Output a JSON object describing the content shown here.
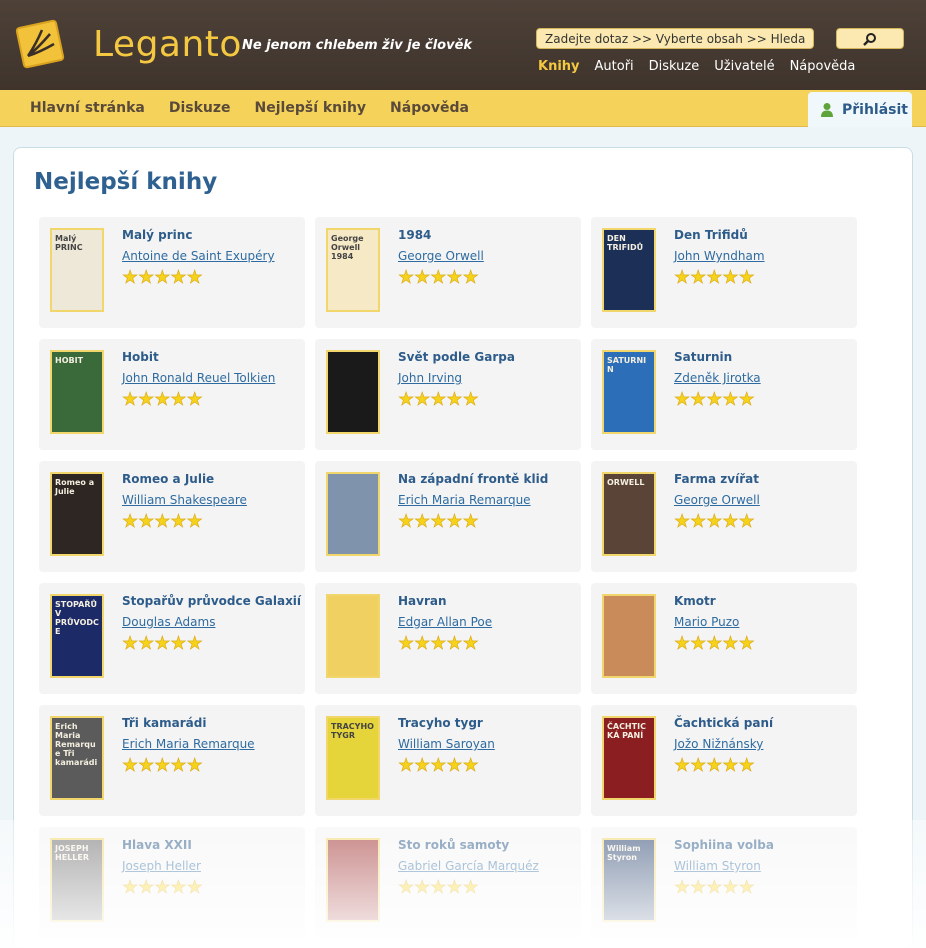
{
  "brand": {
    "name": "Leganto",
    "tagline": "Ne jenom chlebem živ je člověk"
  },
  "search": {
    "placeholder": "Zadejte dotaz >> Vyberte obsah >> Hledat"
  },
  "top_nav": [
    {
      "label": "Knihy",
      "active": true
    },
    {
      "label": "Autoři",
      "active": false
    },
    {
      "label": "Diskuze",
      "active": false
    },
    {
      "label": "Uživatelé",
      "active": false
    },
    {
      "label": "Nápověda",
      "active": false
    }
  ],
  "sub_nav": [
    "Hlavní stránka",
    "Diskuze",
    "Nejlepší knihy",
    "Nápověda"
  ],
  "login": {
    "label": "Přihlásit"
  },
  "page": {
    "title": "Nejlepší knihy"
  },
  "colors": {
    "header": "#4a3e36",
    "accent": "#f5c842",
    "bar": "#f5d35a",
    "link": "#2e5c8a"
  },
  "books": [
    {
      "title": "Malý princ",
      "author": "Antoine de Saint Exupéry",
      "rating": 5,
      "cover_color": "#ede8d8",
      "cover_text": "Malý PRINC"
    },
    {
      "title": "1984",
      "author": "George Orwell",
      "rating": 5,
      "cover_color": "#f6e9c6",
      "cover_text": "George Orwell 1984"
    },
    {
      "title": "Den Trifidů",
      "author": "John Wyndham",
      "rating": 5,
      "cover_color": "#1c2f57",
      "cover_text": "DEN TRIFIDŮ"
    },
    {
      "title": "Hobit",
      "author": "John Ronald Reuel Tolkien",
      "rating": 5,
      "cover_color": "#3b6a3a",
      "cover_text": "HOBIT"
    },
    {
      "title": "Svět podle Garpa",
      "author": "John Irving",
      "rating": 5,
      "cover_color": "#1a1a1a",
      "cover_text": ""
    },
    {
      "title": "Saturnin",
      "author": "Zdeněk Jirotka",
      "rating": 5,
      "cover_color": "#2c6fb8",
      "cover_text": "SATURNIN"
    },
    {
      "title": "Romeo a Julie",
      "author": "William Shakespeare",
      "rating": 5,
      "cover_color": "#2d2622",
      "cover_text": "Romeo a Julie"
    },
    {
      "title": "Na západní frontě klid",
      "author": "Erich Maria Remarque",
      "rating": 5,
      "cover_color": "#7f93ad",
      "cover_text": ""
    },
    {
      "title": "Farma zvířat",
      "author": "George Orwell",
      "rating": 5,
      "cover_color": "#5a4438",
      "cover_text": "ORWELL"
    },
    {
      "title": "Stopařův průvodce Galaxií",
      "author": "Douglas Adams",
      "rating": 5,
      "cover_color": "#1d2a68",
      "cover_text": "STOPAŘŮV PRŮVODCE"
    },
    {
      "title": "Havran",
      "author": "Edgar Allan Poe",
      "rating": 5,
      "cover_color": "#f0d060",
      "cover_text": ""
    },
    {
      "title": "Kmotr",
      "author": "Mario Puzo",
      "rating": 5,
      "cover_color": "#c98b5a",
      "cover_text": ""
    },
    {
      "title": "Tři kamarádi",
      "author": "Erich Maria Remarque",
      "rating": 5,
      "cover_color": "#5b5b5b",
      "cover_text": "Erich Maria Remarque Tři kamarádi"
    },
    {
      "title": "Tracyho tygr",
      "author": "William Saroyan",
      "rating": 5,
      "cover_color": "#e5d43a",
      "cover_text": "TRACYHO TYGR"
    },
    {
      "title": "Čachtická paní",
      "author": "Jožo Nižnánsky",
      "rating": 5,
      "cover_color": "#8a1e20",
      "cover_text": "ČACHTICKÁ PANÍ"
    },
    {
      "title": "Hlava XXII",
      "author": "Joseph Heller",
      "rating": 5,
      "cover_color": "#6e6e6e",
      "cover_text": "JOSEPH HELLER"
    },
    {
      "title": "Sto roků samoty",
      "author": "Gabriel García Marquéz",
      "rating": 5,
      "cover_color": "#a03030",
      "cover_text": ""
    },
    {
      "title": "Sophiina volba",
      "author": "William Styron",
      "rating": 5,
      "cover_color": "#2b4570",
      "cover_text": "William Styron"
    }
  ]
}
